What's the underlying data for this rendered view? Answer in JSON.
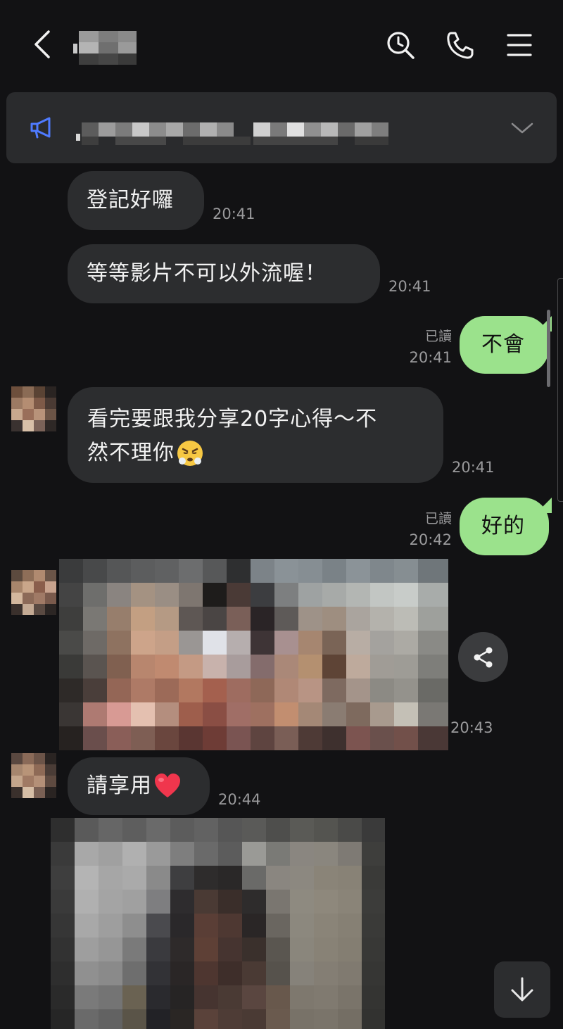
{
  "colors": {
    "background": "#121214",
    "incoming_bubble": "#2c2d2f",
    "outgoing_bubble": "#9be28c",
    "announce_bg": "#2a2b2d",
    "timestamp": "#9a9a9c",
    "announce_icon": "#4f7bff"
  },
  "header": {
    "icons": [
      "back-arrow-icon",
      "search-clock-icon",
      "phone-icon",
      "menu-icon"
    ]
  },
  "announcement": {
    "icons": [
      "megaphone-icon",
      "chevron-down-icon"
    ]
  },
  "messages": [
    {
      "side": "in",
      "text": "登記好囉",
      "time": "20:41"
    },
    {
      "side": "in",
      "text": "等等影片不可以外流喔！",
      "time": "20:41"
    },
    {
      "side": "out",
      "text": "不會",
      "read": "已讀",
      "time": "20:41"
    },
    {
      "side": "in",
      "line1": "看完要跟我分享20字心得～不",
      "line2": "然不理你",
      "emoji": "huffing-face-emoji",
      "time": "20:41"
    },
    {
      "side": "out",
      "text": "好的",
      "read": "已讀",
      "time": "20:42"
    },
    {
      "side": "in",
      "type": "image",
      "time": "20:43"
    },
    {
      "side": "in",
      "text": "請享用",
      "emoji": "red-heart-emoji",
      "time": "20:44"
    },
    {
      "side": "in",
      "type": "image"
    }
  ],
  "controls": {
    "icons": [
      "share-icon",
      "arrow-down-icon"
    ]
  }
}
